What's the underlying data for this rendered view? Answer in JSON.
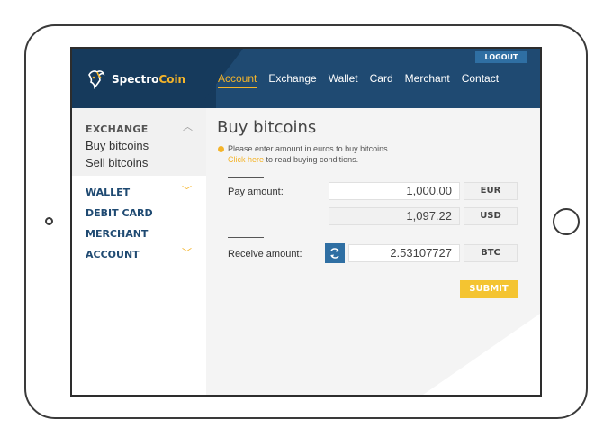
{
  "brand": {
    "name_a": "Spectro",
    "name_b": "Coin",
    "logo_icon": "goat-icon"
  },
  "header": {
    "logout_label": "LOGOUT",
    "nav": [
      "Account",
      "Exchange",
      "Wallet",
      "Card",
      "Merchant",
      "Contact"
    ],
    "active_nav": "Account"
  },
  "sidebar": {
    "exchange_title": "EXCHANGE",
    "exchange_items": [
      "Buy bitcoins",
      "Sell bitcoins"
    ],
    "items": [
      "WALLET",
      "DEBIT CARD",
      "MERCHANT",
      "ACCOUNT"
    ]
  },
  "main": {
    "title": "Buy bitcoins",
    "info_text": "Please enter amount in euros to buy bitcoins.",
    "info_link": "Click here",
    "info_link_rest": " to read buying conditions.",
    "pay_label": "Pay amount:",
    "pay_value": "1,000.00",
    "pay_currency": "EUR",
    "usd_value": "1,097.22",
    "usd_currency": "USD",
    "receive_label": "Receive amount:",
    "receive_value": "2.53107727",
    "receive_currency": "BTC",
    "submit_label": "SUBMIT"
  },
  "colors": {
    "header": "#1f4a72",
    "accent": "#f4b42a",
    "button_blue": "#2f6fa3",
    "submit": "#f4c431"
  }
}
